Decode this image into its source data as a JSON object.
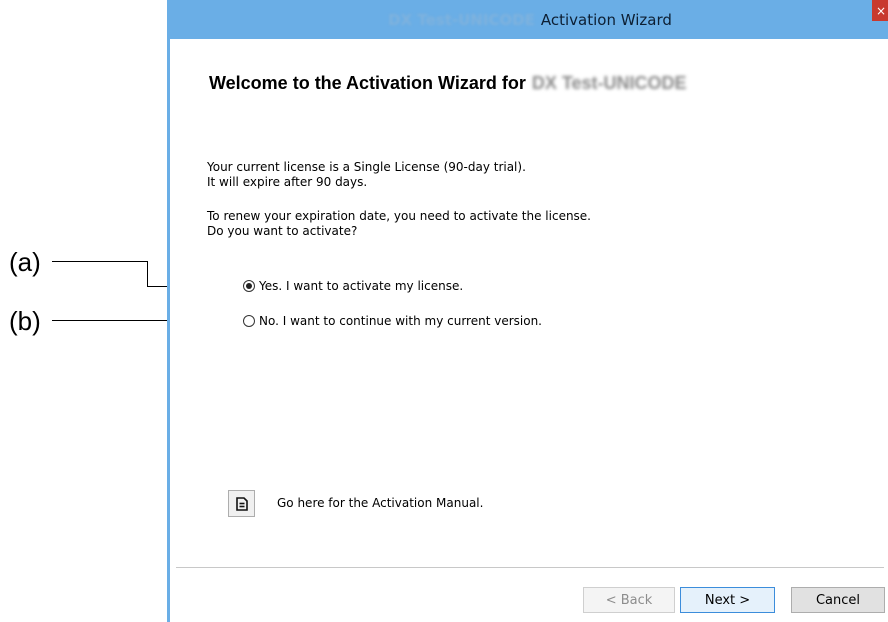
{
  "callouts": {
    "a": "(a)",
    "b": "(b)"
  },
  "window": {
    "title_product": "DX Test-UNICODE",
    "title": "Activation Wizard",
    "close_glyph": "×"
  },
  "content": {
    "heading": "Welcome to the Activation Wizard for",
    "heading_product": "DX Test-UNICODE",
    "license_line1": "Your current license is a Single License (90-day trial).",
    "license_line2": "It will expire after 90 days.",
    "renew_line1": "To renew your expiration date, you need to activate the license.",
    "renew_line2": "Do you want to activate?"
  },
  "options": {
    "yes": {
      "label": "Yes. I want to activate my license.",
      "selected": true
    },
    "no": {
      "label": "No. I want to continue with my current version.",
      "selected": false
    }
  },
  "manual": {
    "icon": "document-icon",
    "label": "Go here for the Activation Manual."
  },
  "buttons": {
    "back": "< Back",
    "next": "Next >",
    "cancel": "Cancel"
  },
  "colors": {
    "titlebar": "#6aaee6",
    "close": "#c8392f",
    "default_border": "#3c8ddb"
  }
}
